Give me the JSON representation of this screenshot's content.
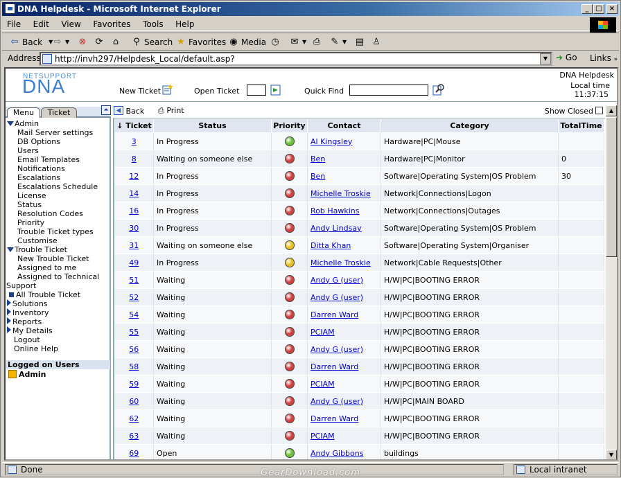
{
  "window": {
    "title": "DNA Helpdesk - Microsoft Internet Explorer"
  },
  "menubar": [
    "File",
    "Edit",
    "View",
    "Favorites",
    "Tools",
    "Help"
  ],
  "toolbar": {
    "back": "Back",
    "search": "Search",
    "favorites": "Favorites",
    "media": "Media"
  },
  "address": {
    "label": "Address",
    "url": "http://invh297/Helpdesk_Local/default.asp?",
    "go": "Go",
    "links": "Links"
  },
  "header": {
    "logo_small": "NETSUPPORT",
    "logo_big": "DNA",
    "new_ticket": "New Ticket",
    "open_ticket": "Open Ticket",
    "quick_find": "Quick Find",
    "app_name": "DNA Helpdesk",
    "local_time_label": "Local time",
    "local_time": "11:37:15"
  },
  "sidebar": {
    "tabs": [
      "Menu",
      "Ticket"
    ],
    "items": [
      {
        "label": "Admin",
        "level": "l1",
        "marker": "down"
      },
      {
        "label": "Mail Server settings",
        "level": "l2"
      },
      {
        "label": "DB Options",
        "level": "l2"
      },
      {
        "label": "Users",
        "level": "l2"
      },
      {
        "label": "Email Templates",
        "level": "l2"
      },
      {
        "label": "Notifications",
        "level": "l2"
      },
      {
        "label": "Escalations",
        "level": "l2"
      },
      {
        "label": "Escalations Schedule",
        "level": "l2"
      },
      {
        "label": "License",
        "level": "l2"
      },
      {
        "label": "Status",
        "level": "l2"
      },
      {
        "label": "Resolution Codes",
        "level": "l2"
      },
      {
        "label": "Priority",
        "level": "l2"
      },
      {
        "label": "Trouble Ticket types",
        "level": "l2"
      },
      {
        "label": "Customise",
        "level": "l2"
      },
      {
        "label": "Trouble Ticket",
        "level": "l1",
        "marker": "down"
      },
      {
        "label": "New Trouble Ticket",
        "level": "l2"
      },
      {
        "label": "Assigned to me",
        "level": "l2"
      },
      {
        "label": "Assigned to Technical",
        "level": "l2"
      },
      {
        "label": "Support",
        "level": "l0"
      },
      {
        "label": "All Trouble Ticket",
        "level": "l1",
        "marker": "square"
      },
      {
        "label": "Solutions",
        "level": "l1",
        "marker": "right"
      },
      {
        "label": "Inventory",
        "level": "l1",
        "marker": "right"
      },
      {
        "label": "Reports",
        "level": "l1",
        "marker": "right"
      },
      {
        "label": "My Details",
        "level": "l1",
        "marker": "right"
      },
      {
        "label": "Logout",
        "level": "l1",
        "marker": "indent"
      },
      {
        "label": "Online Help",
        "level": "l1",
        "marker": "indent"
      }
    ],
    "logged_on_header": "Logged on Users",
    "logged_on_user": "Admin"
  },
  "content_toolbar": {
    "back": "Back",
    "print": "Print",
    "show_closed": "Show Closed"
  },
  "table": {
    "columns": [
      "Ticket",
      "Status",
      "Priority",
      "Contact",
      "Category",
      "TotalTime"
    ],
    "sort_marker": "↓",
    "rows": [
      {
        "ticket": "3",
        "status": "In Progress",
        "priority": "green",
        "contact": "Al Kingsley",
        "category": "Hardware|PC|Mouse",
        "total": ""
      },
      {
        "ticket": "8",
        "status": "Waiting on someone else",
        "priority": "red",
        "contact": "Ben",
        "category": "Hardware|PC|Monitor",
        "total": "0"
      },
      {
        "ticket": "12",
        "status": "In Progress",
        "priority": "red",
        "contact": "Ben",
        "category": "Software|Operating System|OS Problem",
        "total": "30"
      },
      {
        "ticket": "14",
        "status": "In Progress",
        "priority": "red",
        "contact": "Michelle Troskie",
        "category": "Network|Connections|Logon",
        "total": ""
      },
      {
        "ticket": "16",
        "status": "In Progress",
        "priority": "red",
        "contact": "Rob Hawkins",
        "category": "Network|Connections|Outages",
        "total": ""
      },
      {
        "ticket": "30",
        "status": "In Progress",
        "priority": "red",
        "contact": "Andy Lindsay",
        "category": "Software|Operating System|OS Problem",
        "total": ""
      },
      {
        "ticket": "31",
        "status": "Waiting on someone else",
        "priority": "yellow",
        "contact": "Ditta Khan",
        "category": "Software|Operating System|Organiser",
        "total": ""
      },
      {
        "ticket": "49",
        "status": "In Progress",
        "priority": "yellow",
        "contact": "Michelle Troskie",
        "category": "Network|Cable Requests|Other",
        "total": ""
      },
      {
        "ticket": "51",
        "status": "Waiting",
        "priority": "red",
        "contact": "Andy G (user)",
        "category": "H/W|PC|BOOTING ERROR",
        "total": ""
      },
      {
        "ticket": "52",
        "status": "Waiting",
        "priority": "red",
        "contact": "Andy G (user)",
        "category": "H/W|PC|BOOTING ERROR",
        "total": ""
      },
      {
        "ticket": "54",
        "status": "Waiting",
        "priority": "red",
        "contact": "Darren Ward",
        "category": "H/W|PC|BOOTING ERROR",
        "total": ""
      },
      {
        "ticket": "55",
        "status": "Waiting",
        "priority": "red",
        "contact": "PCIAM",
        "category": "H/W|PC|BOOTING ERROR",
        "total": ""
      },
      {
        "ticket": "56",
        "status": "Waiting",
        "priority": "red",
        "contact": "Andy G (user)",
        "category": "H/W|PC|BOOTING ERROR",
        "total": ""
      },
      {
        "ticket": "58",
        "status": "Waiting",
        "priority": "red",
        "contact": "Darren Ward",
        "category": "H/W|PC|BOOTING ERROR",
        "total": ""
      },
      {
        "ticket": "59",
        "status": "Waiting",
        "priority": "red",
        "contact": "PCIAM",
        "category": "H/W|PC|BOOTING ERROR",
        "total": ""
      },
      {
        "ticket": "60",
        "status": "Waiting",
        "priority": "red",
        "contact": "Andy G (user)",
        "category": "H/W|PC|MAIN BOARD",
        "total": ""
      },
      {
        "ticket": "62",
        "status": "Waiting",
        "priority": "red",
        "contact": "Darren Ward",
        "category": "H/W|PC|BOOTING ERROR",
        "total": ""
      },
      {
        "ticket": "63",
        "status": "Waiting",
        "priority": "red",
        "contact": "PCIAM",
        "category": "H/W|PC|BOOTING ERROR",
        "total": ""
      },
      {
        "ticket": "69",
        "status": "Open",
        "priority": "green",
        "contact": "Andy Gibbons",
        "category": "buildings",
        "total": ""
      }
    ]
  },
  "priority_colors": {
    "green": "#6cbf3a",
    "red": "#d04040",
    "yellow": "#e8c020"
  },
  "statusbar": {
    "text": "Done",
    "zone": "Local intranet"
  },
  "watermark": "GearDownload.com"
}
